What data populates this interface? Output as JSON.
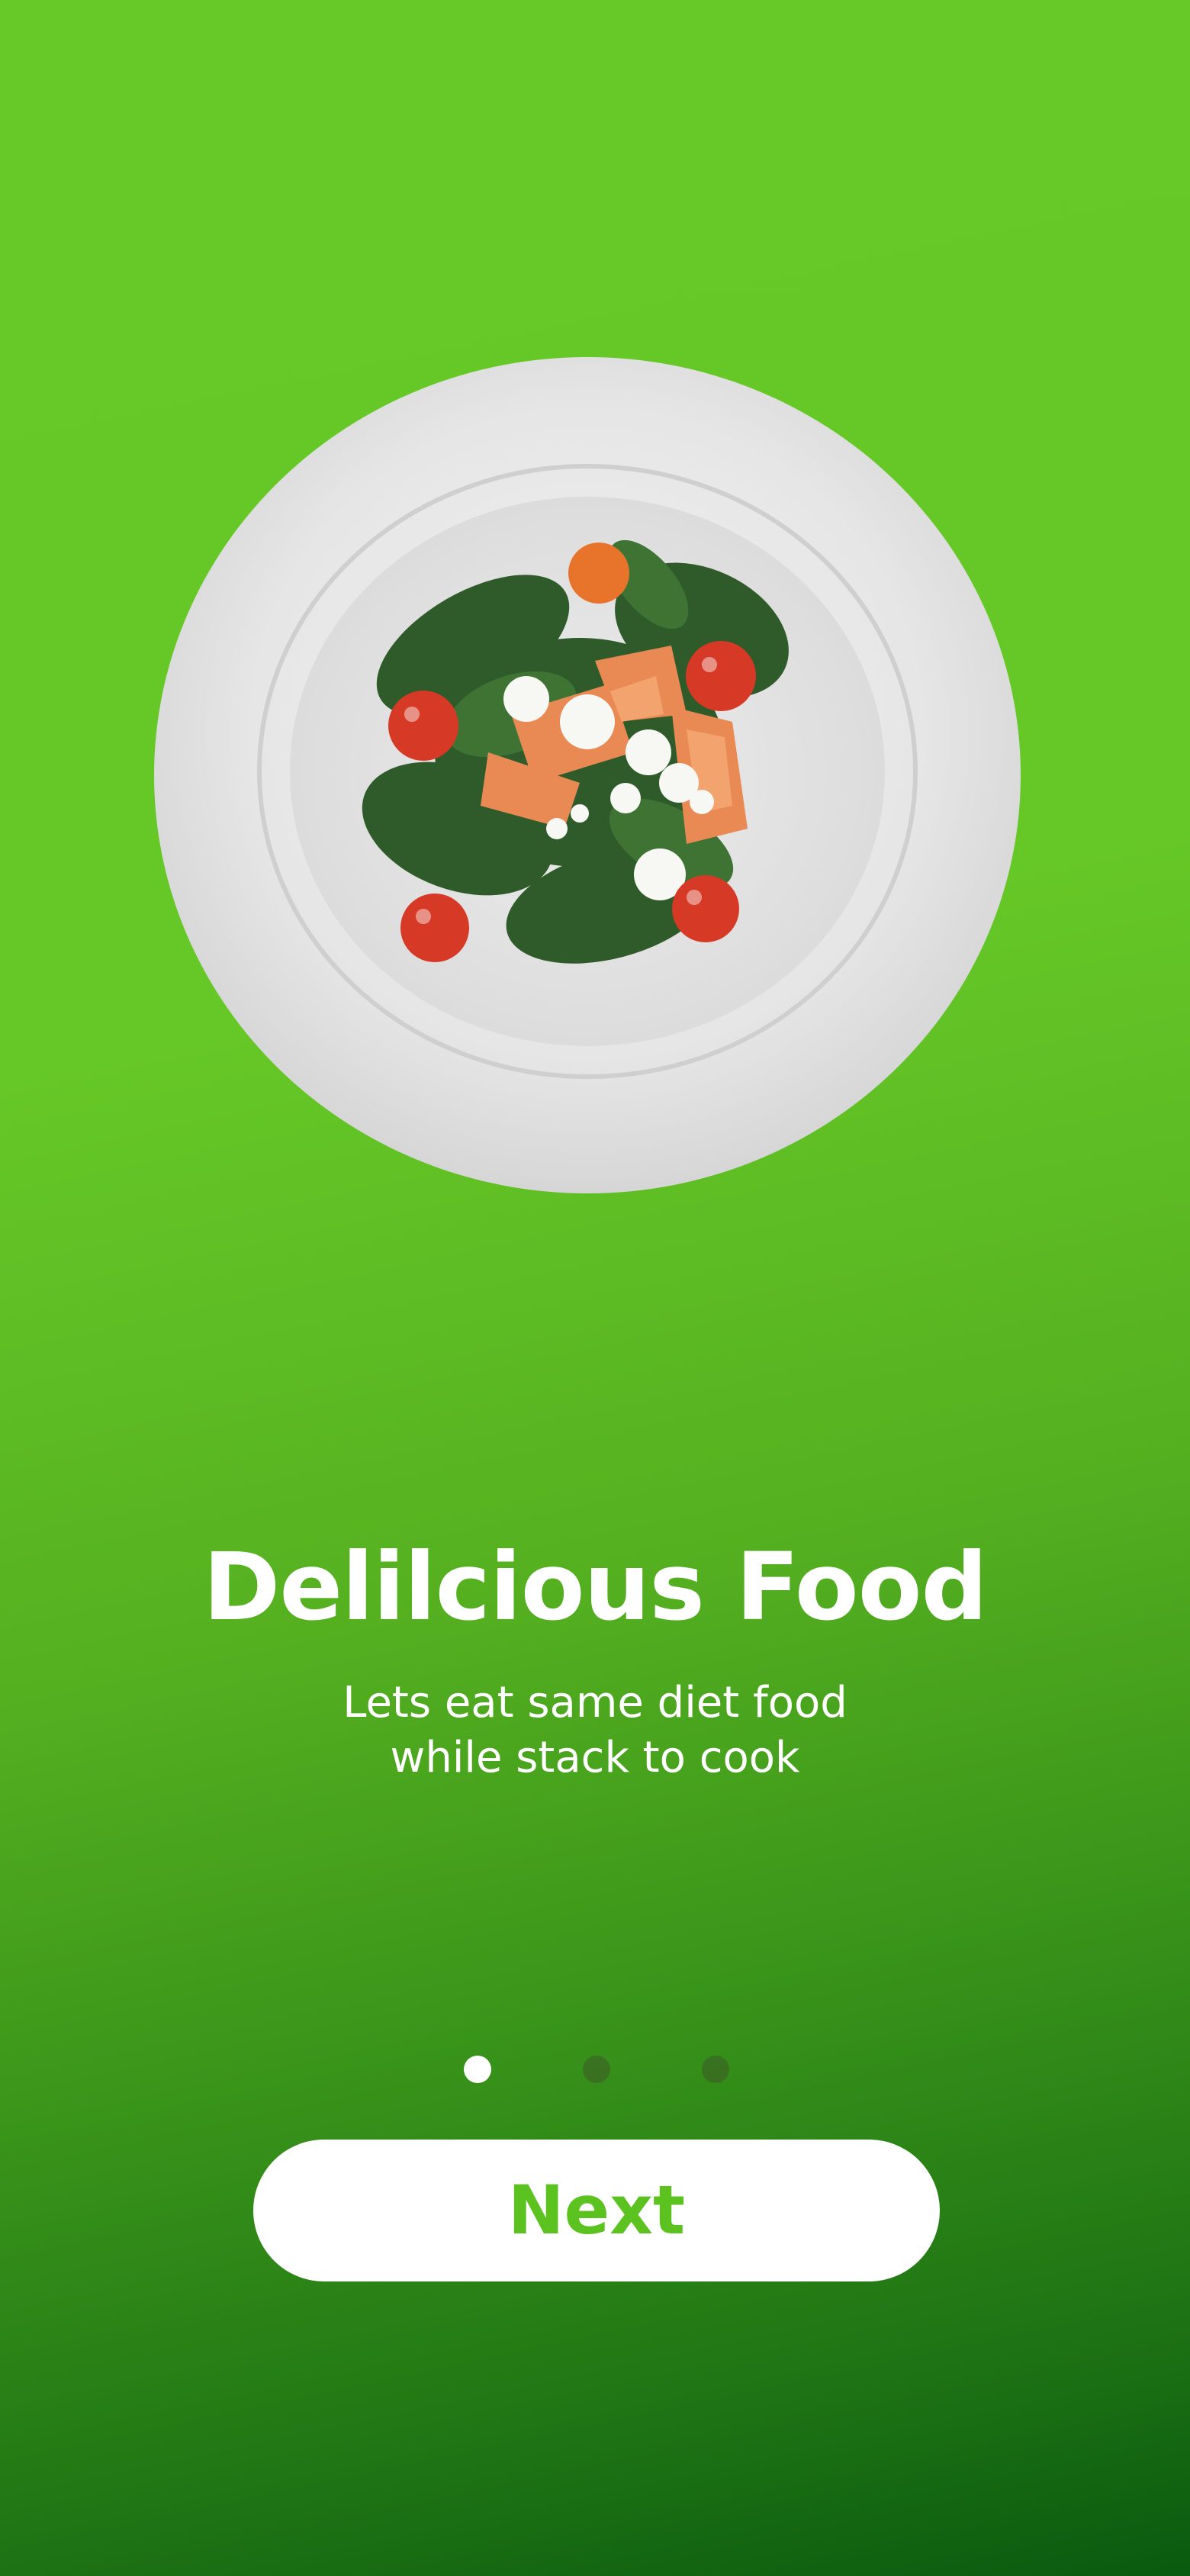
{
  "onboarding": {
    "title": "Delilcious Food",
    "subtitle_lines": [
      "Lets eat same diet food",
      "while stack to cook"
    ],
    "next_label": "Next",
    "pager": {
      "current": 1,
      "total": 3
    }
  },
  "colors": {
    "background_top": "#67c927",
    "background_bottom": "#0a5a0f",
    "button_bg": "#ffffff",
    "button_text": "#5cc21f",
    "dot_active": "#ffffff",
    "dot_inactive": "#4b6b34"
  },
  "illustration": "salad-plate-image"
}
